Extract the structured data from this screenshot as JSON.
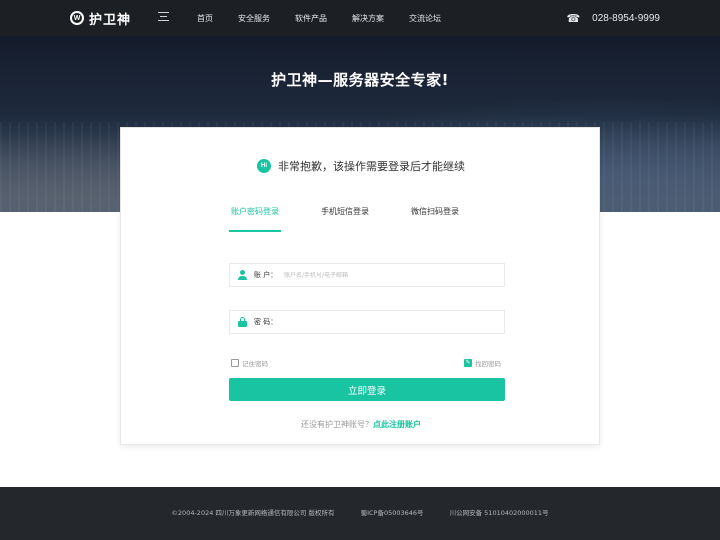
{
  "header": {
    "logo_mark": "W",
    "logo_text": "护卫神",
    "nav": [
      "首页",
      "安全服务",
      "软件产品",
      "解决方案",
      "交流论坛"
    ],
    "phone_icon": "☎",
    "phone": "028-8954-9999"
  },
  "hero": {
    "title": "护卫神—服务器安全专家!"
  },
  "card": {
    "hi_badge": "Hi",
    "message": "非常抱歉，该操作需要登录后才能继续",
    "tabs": [
      "账户密码登录",
      "手机短信登录",
      "微信扫码登录"
    ],
    "active_tab": 0,
    "account_label": "账  户：",
    "account_placeholder": "账户名/手机号/电子邮箱",
    "account_value": "",
    "password_label": "密  码：",
    "password_value": "",
    "remember_label": "记住密码",
    "forgot_label": "找回密码",
    "submit_label": "立即登录",
    "register_prompt": "还没有护卫神账号？",
    "register_link": "点此注册账户"
  },
  "footer": {
    "copyright": "©2004-2024  四川万象更新网络通信有限公司  版权所有",
    "icp": "蜀ICP备05003646号",
    "police": "川公网安备 51010402000011号"
  },
  "colors": {
    "accent": "#19c4a2",
    "topbar": "#1c1f24",
    "footer": "#24272b"
  },
  "icons": {
    "logo": "shield-w-logo",
    "menu": "menu-icon",
    "phone": "telephone-icon",
    "hi": "hi-chat-icon",
    "user": "user-icon",
    "lock": "lock-icon",
    "checkbox": "checkbox-icon"
  }
}
